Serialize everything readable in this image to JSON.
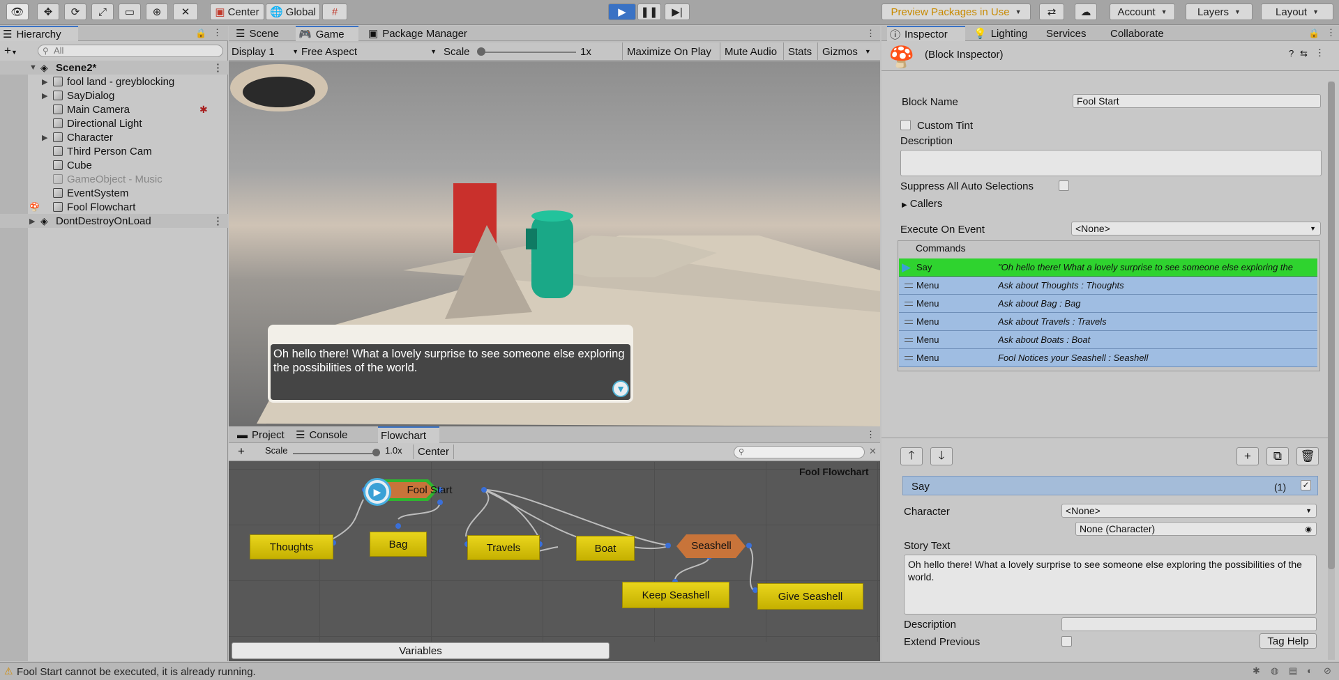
{
  "toolbar": {
    "pivot_center": "Center",
    "pivot_global": "Global",
    "preview_packages": "Preview Packages in Use",
    "account": "Account",
    "layers": "Layers",
    "layout": "Layout"
  },
  "hierarchy": {
    "tab": "Hierarchy",
    "search_placeholder": "All",
    "scene": "Scene2*",
    "items": [
      "fool land - greyblocking",
      "SayDialog",
      "Main Camera",
      "Directional Light",
      "Character",
      "Third Person Cam",
      "Cube",
      "GameObject - Music",
      "EventSystem",
      "Fool Flowchart"
    ],
    "dont_destroy": "DontDestroyOnLoad"
  },
  "center_tabs": {
    "scene": "Scene",
    "game": "Game",
    "package_manager": "Package Manager"
  },
  "game_bar": {
    "display": "Display 1",
    "aspect": "Free Aspect",
    "scale_label": "Scale",
    "scale_value": "1x",
    "maximize": "Maximize On Play",
    "mute": "Mute Audio",
    "stats": "Stats",
    "gizmos": "Gizmos"
  },
  "say_dialog": {
    "text": "Oh hello there! What a lovely surprise to see someone else exploring the possibilities of the world."
  },
  "bottom_tabs": {
    "project": "Project",
    "console": "Console",
    "flowchart": "Flowchart"
  },
  "flowchart": {
    "scale_label": "Scale",
    "scale_value": "1.0x",
    "center_button": "Center",
    "title": "Fool Flowchart",
    "nodes": {
      "fool_start": "Fool Start",
      "thoughts": "Thoughts",
      "bag": "Bag",
      "travels": "Travels",
      "boat": "Boat",
      "seashell": "Seashell",
      "keep_seashell": "Keep Seashell",
      "give_seashell": "Give Seashell"
    },
    "variables": "Variables"
  },
  "inspector_tabs": {
    "inspector": "Inspector",
    "lighting": "Lighting",
    "services": "Services",
    "collaborate": "Collaborate"
  },
  "inspector": {
    "header": "(Block Inspector)",
    "block_name_label": "Block Name",
    "block_name_value": "Fool Start",
    "custom_tint": "Custom Tint",
    "description_label": "Description",
    "suppress_label": "Suppress All Auto Selections",
    "callers": "Callers",
    "execute_label": "Execute On Event",
    "execute_value": "<None>",
    "commands_label": "Commands",
    "commands": [
      {
        "name": "Say",
        "desc": "\"Oh hello there! What a lovely surprise to see someone else exploring the"
      },
      {
        "name": "Menu",
        "desc": "Ask about Thoughts : Thoughts"
      },
      {
        "name": "Menu",
        "desc": "Ask about Bag : Bag"
      },
      {
        "name": "Menu",
        "desc": "Ask about Travels : Travels"
      },
      {
        "name": "Menu",
        "desc": "Ask about Boats : Boat"
      },
      {
        "name": "Menu",
        "desc": "Fool Notices your Seashell : Seashell"
      }
    ],
    "say": {
      "title": "Say",
      "count": "(1)",
      "character_label": "Character",
      "character_value": "<None>",
      "character_object": "None (Character)",
      "story_label": "Story Text",
      "story_text": "Oh hello there! What a lovely surprise to see someone else exploring the possibilities of the world.",
      "description_label": "Description",
      "extend_label": "Extend Previous",
      "tag_help": "Tag Help"
    }
  },
  "status": {
    "message": "Fool Start cannot be executed, it is already running."
  },
  "colors": {
    "accent": "#3a72c4",
    "executing": "#2fd32f",
    "command_bg": "#9fbde2",
    "node_yellow": "#d9c313",
    "node_orange": "#c8743a"
  }
}
